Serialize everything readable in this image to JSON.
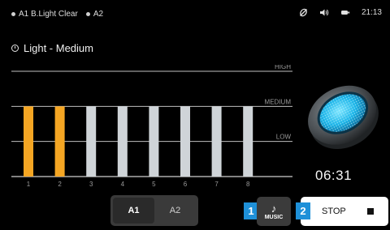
{
  "status_bar": {
    "items": [
      "A1 B.Light Clear",
      "A2"
    ],
    "time": "21:13"
  },
  "mode_title": "Light - Medium",
  "chart_data": {
    "type": "bar",
    "categories": [
      "1",
      "2",
      "3",
      "4",
      "5",
      "6",
      "7",
      "8"
    ],
    "values": [
      2,
      2,
      2,
      2,
      2,
      2,
      2,
      2
    ],
    "levels": [
      "HIGH",
      "MEDIUM",
      "LOW"
    ],
    "ylim": [
      0,
      3
    ],
    "active_color": "#f5a623",
    "inactive_color": "#cfd4d8",
    "active_bars": [
      1,
      2
    ]
  },
  "clock": "06:31",
  "segment": {
    "options": [
      "A1",
      "A2"
    ],
    "selected": "A1"
  },
  "badges": [
    "1",
    "2"
  ],
  "music": {
    "label": "MUSIC",
    "icon": "music-note-icon"
  },
  "stop": {
    "label": "STOP",
    "icon": "stop-icon"
  }
}
